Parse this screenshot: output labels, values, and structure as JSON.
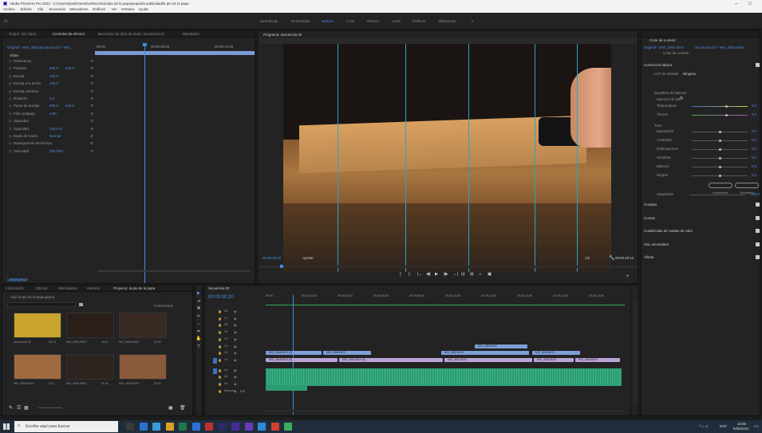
{
  "window": {
    "title": "Adobe Premiere Pro 2020 - C:\\Users\\elpuli\\OneDrive\\Escritorio\\pto de la papa\\pequeña publicidad\\la pto de la papa",
    "min_glyph": "–",
    "max_glyph": "◻"
  },
  "menu": [
    "Archivo",
    "Edición",
    "Clip",
    "Secuencia",
    "Marcadores",
    "Gráficos",
    "Ver",
    "Ventana",
    "Ayuda"
  ],
  "workspaces": [
    "Aprendizaje",
    "Ensamblaje",
    "Edición",
    "Color",
    "Efectos",
    "Audio",
    "Gráficos",
    "Bibliotecas"
  ],
  "active_workspace": "Edición",
  "effect_controls": {
    "tabs": [
      "Origen: (sin clips)",
      "Controles de efectos",
      "Mezclador de clips de audio: Secuencia 02",
      "Metadatos"
    ],
    "source_label": "Original * MVI_4053_...",
    "seq_label": "Secuencia 02 * MVI_...",
    "timecode_start": "00:00",
    "timecode_mid": "00:00:05:00",
    "timecode_end": "00:00:10:00",
    "clip_label": "MVI_4053.MOV",
    "video_header": "Vídeo",
    "fx": [
      {
        "name": "Movimiento",
        "v1": "",
        "v2": ""
      },
      {
        "name": "Posición",
        "v1": "960,0",
        "v2": "540,0"
      },
      {
        "name": "Escala",
        "v1": "100,0",
        "v2": ""
      },
      {
        "name": "Escala a lo ancho",
        "v1": "100,0",
        "v2": ""
      },
      {
        "name": "Escala uniforme",
        "v1": "",
        "v2": ""
      },
      {
        "name": "Rotación",
        "v1": "0,0",
        "v2": ""
      },
      {
        "name": "Punto de anclaje",
        "v1": "960,0",
        "v2": "540,0"
      },
      {
        "name": "Filtro antiparp.",
        "v1": "0,00",
        "v2": ""
      },
      {
        "name": "Opacidad",
        "v1": "",
        "v2": ""
      },
      {
        "name": "Opacidad",
        "v1": "100,0 %",
        "v2": ""
      },
      {
        "name": "Modo de fusión",
        "v1": "Normal",
        "v2": ""
      },
      {
        "name": "Reasignación del tiempo",
        "v1": "",
        "v2": ""
      },
      {
        "name": "Velocidad",
        "v1": "100,00%",
        "v2": ""
      }
    ],
    "footer_tc": "00:00:00:20"
  },
  "program": {
    "title": "Programa: Secuencia 02",
    "timecode": "00:00:00:20",
    "fit": "Ajustar",
    "ratio": "1/2",
    "duration": "00:00:20:14",
    "controls": [
      "{",
      "}",
      "|←",
      "◀|",
      "▶",
      "|▶",
      "→|",
      "⊟",
      "⊞",
      "⌂",
      "▣"
    ]
  },
  "lumetri": {
    "title": "Color de Lumetri",
    "source": "Original * MVI_4053.MOV",
    "seq": "Secuencia 02 * MVI_4053.MOV",
    "sub": "Color de Lumetri",
    "basic": "Corrección básica",
    "lut_label": "LUT de entrada",
    "lut_value": "Ninguno",
    "wb_label": "Equilibrio de blancos",
    "wb_selector": "Selector de WB",
    "params": [
      {
        "name": "Temperatura",
        "value": "0,0",
        "pos": 0.62
      },
      {
        "name": "Tinción",
        "value": "0,0",
        "pos": 0.62
      }
    ],
    "tone": "Tono",
    "tone_params": [
      {
        "name": "Exposición",
        "value": "0,0",
        "pos": 0.5
      },
      {
        "name": "Contraste",
        "value": "0,0",
        "pos": 0.5
      },
      {
        "name": "Iluminaciones",
        "value": "0,0",
        "pos": 0.5
      },
      {
        "name": "Sombras",
        "value": "0,0",
        "pos": 0.5
      },
      {
        "name": "Blancos",
        "value": "0,0",
        "pos": 0.5
      },
      {
        "name": "Negros",
        "value": "0,0",
        "pos": 0.5
      }
    ],
    "reset": "Restablecer",
    "auto": "Automático",
    "saturation": "Saturación",
    "saturation_value": "100,0",
    "sections": [
      "Creativo",
      "Curvas",
      "Cuadrículas de ruedas de color",
      "HSL secundario",
      "Viñeta"
    ]
  },
  "project": {
    "tabs": [
      "Información",
      "Efectos",
      "Marcadores",
      "Historial",
      "Proyecto: la pto de la papa"
    ],
    "path": "Clip: la pto de la papa.prproj",
    "item_count": "9 elementos",
    "items": [
      {
        "name": "Secuencia 02",
        "dur": "20:14"
      },
      {
        "name": "MVI_4053.MOV",
        "dur": "15:07"
      },
      {
        "name": "MVI_4050.MOV",
        "dur": "11:02"
      },
      {
        "name": "MVI_4054.MOV",
        "dur": "6:21"
      },
      {
        "name": "MVI_4051.MOV",
        "dur": "11:04"
      },
      {
        "name": "MVI_4049.MOV",
        "dur": "22:01"
      }
    ],
    "header_tc": "00:00:00:20"
  },
  "timeline": {
    "tab": "Secuencia 02",
    "timecode": "00:00:00:20",
    "ruler": [
      "00:00",
      "00:00:02:00",
      "00:00:04:00",
      "00:00:06:00",
      "00:00:08:00",
      "00:00:10:00",
      "00:00:12:00",
      "00:00:14:00",
      "00:00:16:00",
      "00:00:18:00"
    ],
    "tracks": [
      "V8",
      "V7",
      "V6",
      "V5",
      "V4",
      "V3",
      "V2",
      "V1",
      "A1",
      "A2",
      "A3",
      "Maestro"
    ],
    "master_value": "0,0",
    "v_clips": [
      {
        "label": "MVI_4048.MOV [V]",
        "row": 0
      },
      {
        "label": "MVI_4050.MOV",
        "row": 1
      },
      {
        "label": "MVI_4053.MOV",
        "row": 2
      },
      {
        "label": "MVI_4054.MOV [V]",
        "row": 3
      },
      {
        "label": "MVI_4051.MOV",
        "row": 4
      },
      {
        "label": "MVI_4049.MOV",
        "row": 5
      }
    ]
  },
  "taskbar": {
    "search_placeholder": "Escribe aquí para buscar",
    "lang": "ESP",
    "time": "22:55",
    "date": "6/06/2021"
  }
}
